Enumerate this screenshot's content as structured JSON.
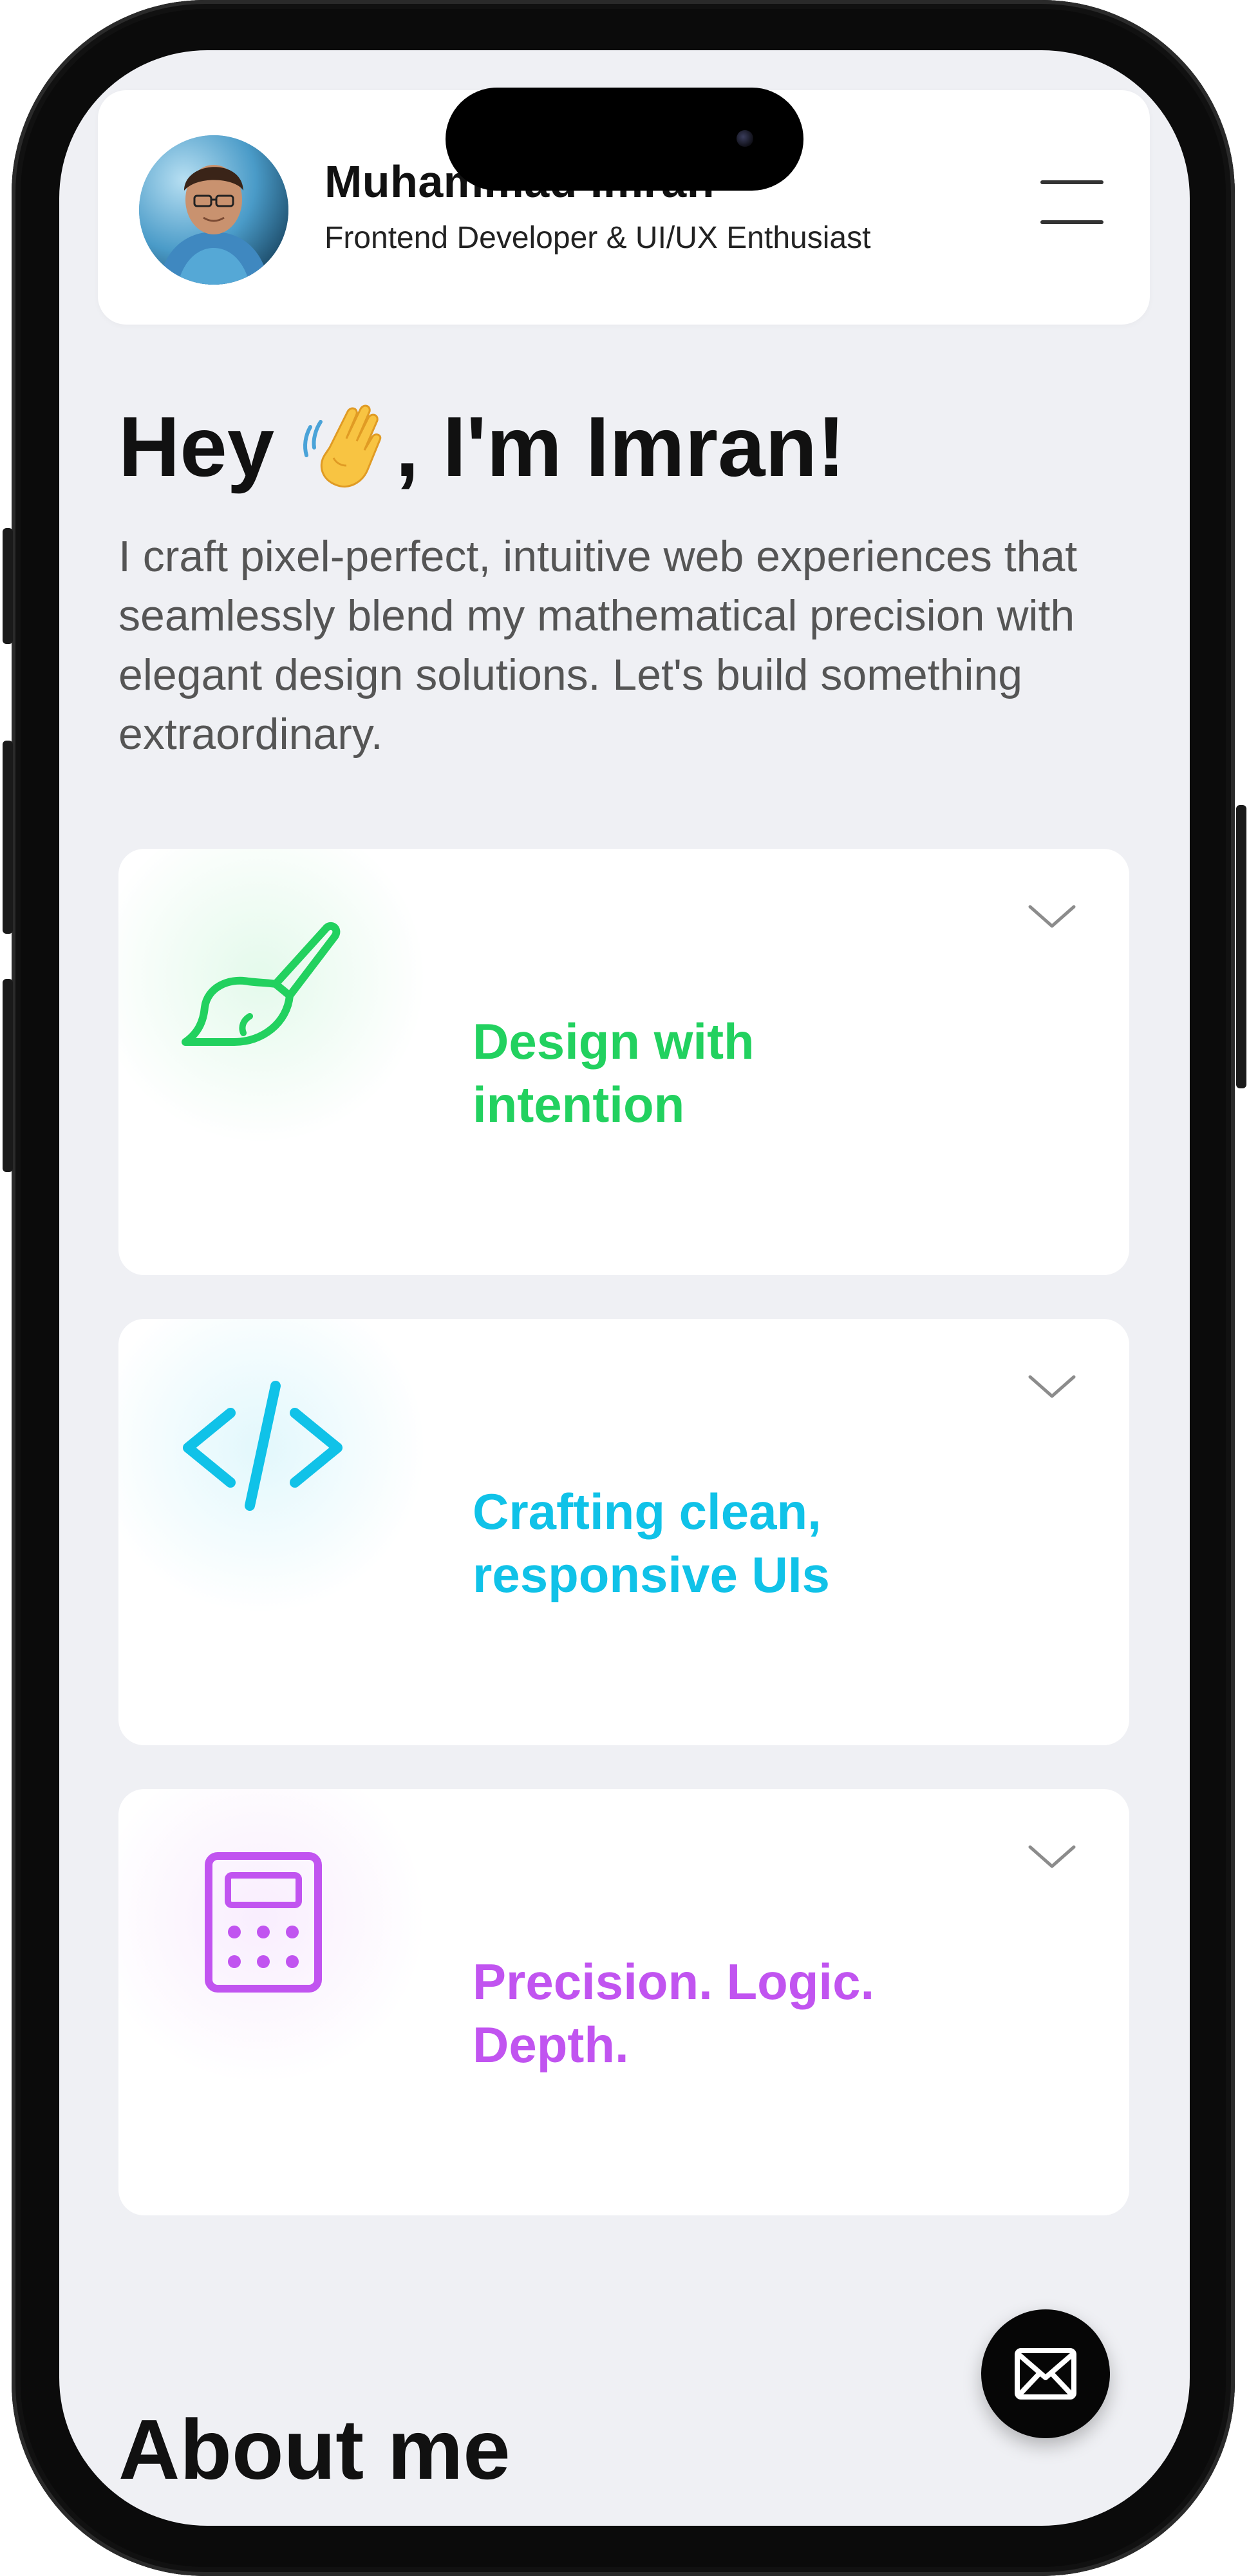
{
  "profile": {
    "name": "Muhammad Imran",
    "role": "Frontend Developer & UI/UX Enthusiast"
  },
  "hero": {
    "title_prefix": "Hey",
    "title_suffix": ", I'm Imran!",
    "wave_icon": "waving-hand-icon",
    "description": "I craft pixel-perfect, intuitive web experiences that seamlessly blend my mathematical precision with elegant design solutions. Let's build something extraordinary."
  },
  "features": [
    {
      "title": "Design with intention",
      "icon": "paintbrush-icon",
      "color": "#22d15f"
    },
    {
      "title": "Crafting clean, responsive UIs",
      "icon": "code-icon",
      "color": "#10c2e8"
    },
    {
      "title": "Precision. Logic. Depth.",
      "icon": "calculator-icon",
      "color": "#c154f0"
    }
  ],
  "about": {
    "title": "About me"
  },
  "colors": {
    "background": "#eff0f4",
    "card": "#ffffff",
    "text": "#111111",
    "muted": "#555555"
  }
}
